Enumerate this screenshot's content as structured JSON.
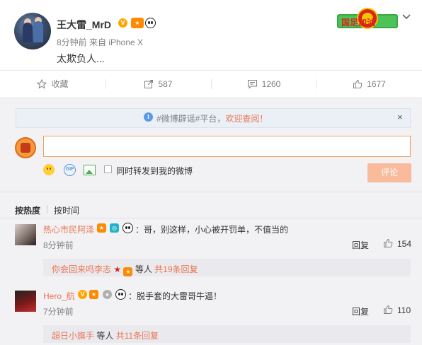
{
  "post": {
    "username": "王大雷_MrD",
    "time_source": "8分钟前 来自 iPhone X",
    "text": "太欺负人...",
    "promo_text": "国足加油"
  },
  "actions": {
    "favorite": "收藏",
    "repost": "587",
    "comment": "1260",
    "like": "1677"
  },
  "notice": {
    "text_prefix": "#微博辟谣#平台，",
    "link": "欢迎查阅！",
    "close": "×"
  },
  "composer": {
    "checkbox_label": "同时转发到我的微博",
    "submit": "评论"
  },
  "sort": {
    "hot": "按热度",
    "time": "按时间"
  },
  "comments": [
    {
      "name": "热心市民阿泽",
      "text": "：哥，别这样，小心被开罚单，不值当的",
      "time": "8分钟前",
      "reply_label": "回复",
      "likes": "154",
      "sub_name": "你会回来吗李志",
      "sub_middle": "等人",
      "sub_link": "共19条回复"
    },
    {
      "name": "Hero_航",
      "text": "：脱手套的大雷哥牛逼！",
      "time": "7分钟前",
      "reply_label": "回复",
      "likes": "110",
      "sub_name": "超日小旗手",
      "sub_middle": "等人",
      "sub_link": "共11条回复"
    }
  ],
  "colors": {
    "accent": "#eb7350",
    "muted": "#808080",
    "panel": "#f2f2f5",
    "submit_disabled": "#fabb9c"
  }
}
